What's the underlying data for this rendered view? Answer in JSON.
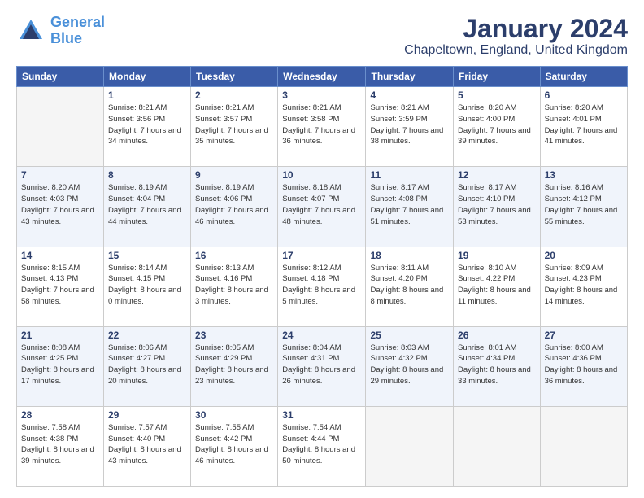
{
  "logo": {
    "line1": "General",
    "line2": "Blue"
  },
  "title": "January 2024",
  "location": "Chapeltown, England, United Kingdom",
  "weekdays": [
    "Sunday",
    "Monday",
    "Tuesday",
    "Wednesday",
    "Thursday",
    "Friday",
    "Saturday"
  ],
  "weeks": [
    [
      {
        "day": "",
        "sunrise": "",
        "sunset": "",
        "daylight": ""
      },
      {
        "day": "1",
        "sunrise": "Sunrise: 8:21 AM",
        "sunset": "Sunset: 3:56 PM",
        "daylight": "Daylight: 7 hours and 34 minutes."
      },
      {
        "day": "2",
        "sunrise": "Sunrise: 8:21 AM",
        "sunset": "Sunset: 3:57 PM",
        "daylight": "Daylight: 7 hours and 35 minutes."
      },
      {
        "day": "3",
        "sunrise": "Sunrise: 8:21 AM",
        "sunset": "Sunset: 3:58 PM",
        "daylight": "Daylight: 7 hours and 36 minutes."
      },
      {
        "day": "4",
        "sunrise": "Sunrise: 8:21 AM",
        "sunset": "Sunset: 3:59 PM",
        "daylight": "Daylight: 7 hours and 38 minutes."
      },
      {
        "day": "5",
        "sunrise": "Sunrise: 8:20 AM",
        "sunset": "Sunset: 4:00 PM",
        "daylight": "Daylight: 7 hours and 39 minutes."
      },
      {
        "day": "6",
        "sunrise": "Sunrise: 8:20 AM",
        "sunset": "Sunset: 4:01 PM",
        "daylight": "Daylight: 7 hours and 41 minutes."
      }
    ],
    [
      {
        "day": "7",
        "sunrise": "Sunrise: 8:20 AM",
        "sunset": "Sunset: 4:03 PM",
        "daylight": "Daylight: 7 hours and 43 minutes."
      },
      {
        "day": "8",
        "sunrise": "Sunrise: 8:19 AM",
        "sunset": "Sunset: 4:04 PM",
        "daylight": "Daylight: 7 hours and 44 minutes."
      },
      {
        "day": "9",
        "sunrise": "Sunrise: 8:19 AM",
        "sunset": "Sunset: 4:06 PM",
        "daylight": "Daylight: 7 hours and 46 minutes."
      },
      {
        "day": "10",
        "sunrise": "Sunrise: 8:18 AM",
        "sunset": "Sunset: 4:07 PM",
        "daylight": "Daylight: 7 hours and 48 minutes."
      },
      {
        "day": "11",
        "sunrise": "Sunrise: 8:17 AM",
        "sunset": "Sunset: 4:08 PM",
        "daylight": "Daylight: 7 hours and 51 minutes."
      },
      {
        "day": "12",
        "sunrise": "Sunrise: 8:17 AM",
        "sunset": "Sunset: 4:10 PM",
        "daylight": "Daylight: 7 hours and 53 minutes."
      },
      {
        "day": "13",
        "sunrise": "Sunrise: 8:16 AM",
        "sunset": "Sunset: 4:12 PM",
        "daylight": "Daylight: 7 hours and 55 minutes."
      }
    ],
    [
      {
        "day": "14",
        "sunrise": "Sunrise: 8:15 AM",
        "sunset": "Sunset: 4:13 PM",
        "daylight": "Daylight: 7 hours and 58 minutes."
      },
      {
        "day": "15",
        "sunrise": "Sunrise: 8:14 AM",
        "sunset": "Sunset: 4:15 PM",
        "daylight": "Daylight: 8 hours and 0 minutes."
      },
      {
        "day": "16",
        "sunrise": "Sunrise: 8:13 AM",
        "sunset": "Sunset: 4:16 PM",
        "daylight": "Daylight: 8 hours and 3 minutes."
      },
      {
        "day": "17",
        "sunrise": "Sunrise: 8:12 AM",
        "sunset": "Sunset: 4:18 PM",
        "daylight": "Daylight: 8 hours and 5 minutes."
      },
      {
        "day": "18",
        "sunrise": "Sunrise: 8:11 AM",
        "sunset": "Sunset: 4:20 PM",
        "daylight": "Daylight: 8 hours and 8 minutes."
      },
      {
        "day": "19",
        "sunrise": "Sunrise: 8:10 AM",
        "sunset": "Sunset: 4:22 PM",
        "daylight": "Daylight: 8 hours and 11 minutes."
      },
      {
        "day": "20",
        "sunrise": "Sunrise: 8:09 AM",
        "sunset": "Sunset: 4:23 PM",
        "daylight": "Daylight: 8 hours and 14 minutes."
      }
    ],
    [
      {
        "day": "21",
        "sunrise": "Sunrise: 8:08 AM",
        "sunset": "Sunset: 4:25 PM",
        "daylight": "Daylight: 8 hours and 17 minutes."
      },
      {
        "day": "22",
        "sunrise": "Sunrise: 8:06 AM",
        "sunset": "Sunset: 4:27 PM",
        "daylight": "Daylight: 8 hours and 20 minutes."
      },
      {
        "day": "23",
        "sunrise": "Sunrise: 8:05 AM",
        "sunset": "Sunset: 4:29 PM",
        "daylight": "Daylight: 8 hours and 23 minutes."
      },
      {
        "day": "24",
        "sunrise": "Sunrise: 8:04 AM",
        "sunset": "Sunset: 4:31 PM",
        "daylight": "Daylight: 8 hours and 26 minutes."
      },
      {
        "day": "25",
        "sunrise": "Sunrise: 8:03 AM",
        "sunset": "Sunset: 4:32 PM",
        "daylight": "Daylight: 8 hours and 29 minutes."
      },
      {
        "day": "26",
        "sunrise": "Sunrise: 8:01 AM",
        "sunset": "Sunset: 4:34 PM",
        "daylight": "Daylight: 8 hours and 33 minutes."
      },
      {
        "day": "27",
        "sunrise": "Sunrise: 8:00 AM",
        "sunset": "Sunset: 4:36 PM",
        "daylight": "Daylight: 8 hours and 36 minutes."
      }
    ],
    [
      {
        "day": "28",
        "sunrise": "Sunrise: 7:58 AM",
        "sunset": "Sunset: 4:38 PM",
        "daylight": "Daylight: 8 hours and 39 minutes."
      },
      {
        "day": "29",
        "sunrise": "Sunrise: 7:57 AM",
        "sunset": "Sunset: 4:40 PM",
        "daylight": "Daylight: 8 hours and 43 minutes."
      },
      {
        "day": "30",
        "sunrise": "Sunrise: 7:55 AM",
        "sunset": "Sunset: 4:42 PM",
        "daylight": "Daylight: 8 hours and 46 minutes."
      },
      {
        "day": "31",
        "sunrise": "Sunrise: 7:54 AM",
        "sunset": "Sunset: 4:44 PM",
        "daylight": "Daylight: 8 hours and 50 minutes."
      },
      {
        "day": "",
        "sunrise": "",
        "sunset": "",
        "daylight": ""
      },
      {
        "day": "",
        "sunrise": "",
        "sunset": "",
        "daylight": ""
      },
      {
        "day": "",
        "sunrise": "",
        "sunset": "",
        "daylight": ""
      }
    ]
  ]
}
